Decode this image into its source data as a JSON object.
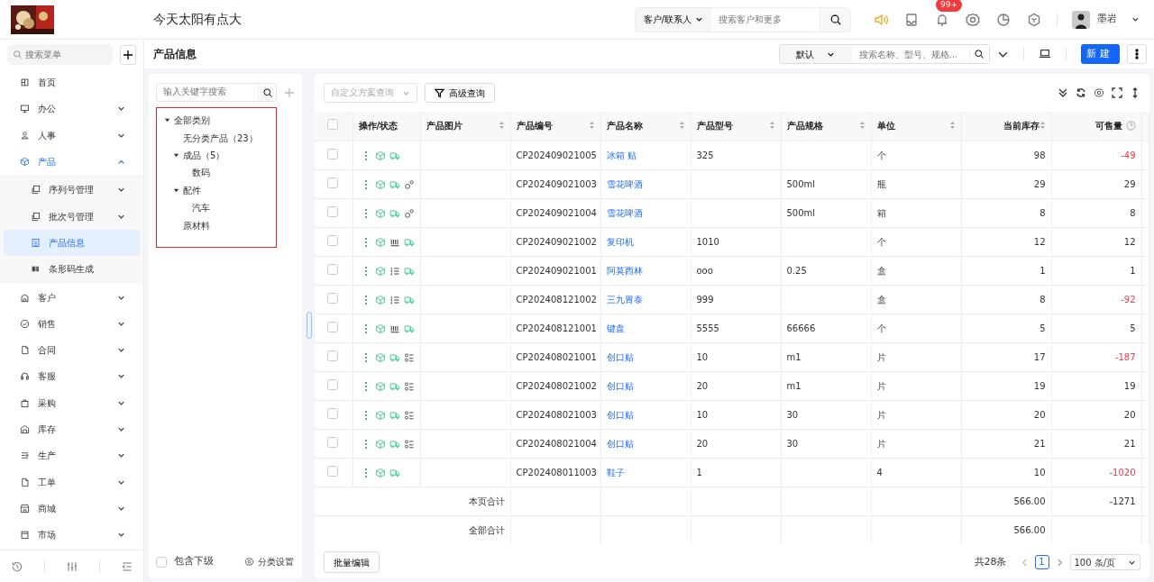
{
  "header": {
    "title": "今天太阳有点大",
    "search_scope": "客户/联系人",
    "search_placeholder": "搜索客户和更多",
    "notification_badge": "99+",
    "user_name": "墨岩"
  },
  "sidebar": {
    "search_placeholder": "搜索菜单",
    "items": [
      {
        "label": "首页",
        "kind": "link",
        "selected": false
      },
      {
        "label": "办公",
        "kind": "group",
        "expanded": false,
        "selected": false
      },
      {
        "label": "人事",
        "kind": "group",
        "expanded": false,
        "selected": false
      },
      {
        "label": "产品",
        "kind": "group",
        "expanded": true,
        "selected": true,
        "children": [
          {
            "label": "序列号管理",
            "kind": "group",
            "expanded": false,
            "selected": false
          },
          {
            "label": "批次号管理",
            "kind": "group",
            "expanded": false,
            "selected": false
          },
          {
            "label": "产品信息",
            "kind": "link",
            "selected": true
          },
          {
            "label": "条形码生成",
            "kind": "link",
            "selected": false
          }
        ]
      },
      {
        "label": "客户",
        "kind": "group",
        "expanded": false,
        "selected": false
      },
      {
        "label": "销售",
        "kind": "group",
        "expanded": false,
        "selected": false
      },
      {
        "label": "合同",
        "kind": "group",
        "expanded": false,
        "selected": false
      },
      {
        "label": "客服",
        "kind": "group",
        "expanded": false,
        "selected": false
      },
      {
        "label": "采购",
        "kind": "group",
        "expanded": false,
        "selected": false
      },
      {
        "label": "库存",
        "kind": "group",
        "expanded": false,
        "selected": false
      },
      {
        "label": "生产",
        "kind": "group",
        "expanded": false,
        "selected": false
      },
      {
        "label": "工单",
        "kind": "group",
        "expanded": false,
        "selected": false
      },
      {
        "label": "商城",
        "kind": "group",
        "expanded": false,
        "selected": false
      },
      {
        "label": "市场",
        "kind": "group",
        "expanded": false,
        "selected": false
      }
    ]
  },
  "page": {
    "title": "产品信息",
    "view_select": "默认",
    "search_placeholder": "搜索名称、型号、规格...",
    "new_button": "新建"
  },
  "category_panel": {
    "search_placeholder": "输入关键字搜索",
    "tree": [
      {
        "label": "全部类别",
        "expanded": true,
        "children": [
          {
            "label": "无分类产品（23）"
          },
          {
            "label": "成品（5）",
            "expanded": true,
            "children": [
              {
                "label": "数码"
              }
            ]
          },
          {
            "label": "配件",
            "expanded": true,
            "children": [
              {
                "label": "汽车"
              }
            ]
          },
          {
            "label": "原材料"
          }
        ]
      }
    ],
    "include_sub": {
      "label": "包含下级",
      "checked": false
    },
    "settings": "分类设置"
  },
  "table_panel": {
    "scheme_placeholder": "自定义方案查询",
    "advanced": "高级查询",
    "all_checked": false,
    "columns": [
      {
        "label": "操作/状态",
        "sortable": false,
        "numeric": false,
        "help": false
      },
      {
        "label": "产品图片",
        "sortable": true,
        "numeric": false,
        "help": false
      },
      {
        "label": "产品编号",
        "sortable": true,
        "numeric": false,
        "help": false
      },
      {
        "label": "产品名称",
        "sortable": true,
        "numeric": false,
        "help": false
      },
      {
        "label": "产品型号",
        "sortable": true,
        "numeric": false,
        "help": false
      },
      {
        "label": "产品规格",
        "sortable": true,
        "numeric": false,
        "help": false
      },
      {
        "label": "单位",
        "sortable": true,
        "numeric": false,
        "help": false
      },
      {
        "label": "当前库存",
        "sortable": true,
        "numeric": true,
        "help": false
      },
      {
        "label": "可售量",
        "sortable": false,
        "numeric": true,
        "help": true
      }
    ],
    "rows": [
      {
        "checked": false,
        "icons": [
          {
            "kind": "cube"
          },
          {
            "kind": "truck"
          }
        ],
        "code": "CP202409021005",
        "name": "冰箱 贴",
        "model": "325",
        "spec": "",
        "unit": "个",
        "stock": "98",
        "saleable": "-49",
        "negative": true
      },
      {
        "checked": false,
        "icons": [
          {
            "kind": "cube"
          },
          {
            "kind": "truck"
          },
          {
            "kind": "gears"
          }
        ],
        "code": "CP202409021003",
        "name": "雪花啤酒",
        "model": "",
        "spec": "500ml",
        "unit": "瓶",
        "stock": "29",
        "saleable": "29",
        "negative": false
      },
      {
        "checked": false,
        "icons": [
          {
            "kind": "cube"
          },
          {
            "kind": "truck"
          },
          {
            "kind": "gears"
          }
        ],
        "code": "CP202409021004",
        "name": "雪花啤酒",
        "model": "",
        "spec": "500ml",
        "unit": "箱",
        "stock": "8",
        "saleable": "8",
        "negative": false
      },
      {
        "checked": false,
        "icons": [
          {
            "kind": "cube"
          },
          {
            "kind": "tally"
          },
          {
            "kind": "truck"
          }
        ],
        "code": "CP202409021002",
        "name": "复印机",
        "model": "1010",
        "spec": "",
        "unit": "个",
        "stock": "12",
        "saleable": "12",
        "negative": false
      },
      {
        "checked": false,
        "icons": [
          {
            "kind": "cube"
          },
          {
            "kind": "ordered-list"
          },
          {
            "kind": "truck"
          }
        ],
        "code": "CP202409021001",
        "name": "阿莫西林",
        "model": "ooo",
        "spec": "0.25",
        "unit": "盒",
        "stock": "1",
        "saleable": "1",
        "negative": false
      },
      {
        "checked": false,
        "icons": [
          {
            "kind": "cube"
          },
          {
            "kind": "ordered-list"
          },
          {
            "kind": "truck"
          }
        ],
        "code": "CP202408121002",
        "name": "三九胃泰",
        "model": "999",
        "spec": "",
        "unit": "盒",
        "stock": "8",
        "saleable": "-92",
        "negative": true
      },
      {
        "checked": false,
        "icons": [
          {
            "kind": "cube"
          },
          {
            "kind": "tally"
          },
          {
            "kind": "truck"
          }
        ],
        "code": "CP202408121001",
        "name": "键盘",
        "model": "5555",
        "spec": "66666",
        "unit": "个",
        "stock": "5",
        "saleable": "5",
        "negative": false
      },
      {
        "checked": false,
        "icons": [
          {
            "kind": "cube"
          },
          {
            "kind": "truck"
          },
          {
            "kind": "node-list"
          }
        ],
        "code": "CP202408021001",
        "name": "创口贴",
        "model": "10",
        "spec": "m1",
        "unit": "片",
        "stock": "17",
        "saleable": "-187",
        "negative": true
      },
      {
        "checked": false,
        "icons": [
          {
            "kind": "cube"
          },
          {
            "kind": "truck"
          },
          {
            "kind": "node-list"
          }
        ],
        "code": "CP202408021002",
        "name": "创口贴",
        "model": "20",
        "spec": "m1",
        "unit": "片",
        "stock": "19",
        "saleable": "19",
        "negative": false
      },
      {
        "checked": false,
        "icons": [
          {
            "kind": "cube"
          },
          {
            "kind": "truck"
          },
          {
            "kind": "node-list"
          }
        ],
        "code": "CP202408021003",
        "name": "创口贴",
        "model": "10",
        "spec": "30",
        "unit": "片",
        "stock": "20",
        "saleable": "20",
        "negative": false
      },
      {
        "checked": false,
        "icons": [
          {
            "kind": "cube"
          },
          {
            "kind": "truck"
          },
          {
            "kind": "node-list"
          }
        ],
        "code": "CP202408021004",
        "name": "创口贴",
        "model": "20",
        "spec": "30",
        "unit": "片",
        "stock": "21",
        "saleable": "21",
        "negative": false
      },
      {
        "checked": false,
        "icons": [
          {
            "kind": "cube"
          },
          {
            "kind": "truck"
          }
        ],
        "code": "CP202408011003",
        "name": "鞋子",
        "model": "1",
        "spec": "",
        "unit": "4",
        "stock": "10",
        "saleable": "-1020",
        "negative": true
      }
    ],
    "totals": [
      {
        "label": "本页合计",
        "stock": "566.00",
        "saleable": "-1271"
      },
      {
        "label": "全部合计",
        "stock": "566.00"
      }
    ],
    "batch_edit": "批量编辑",
    "total_count": "共28条",
    "pages": [
      {
        "label": "1",
        "selected": true
      }
    ],
    "page_size": "100 条/页"
  }
}
